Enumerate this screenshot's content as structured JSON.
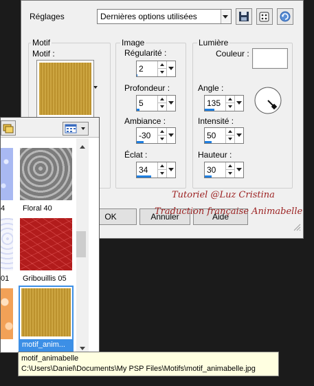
{
  "header": {
    "presets_label": "Réglages",
    "presets_value": "Dernières options utilisées",
    "icons": [
      "save-icon",
      "dice-icon",
      "reset-icon"
    ]
  },
  "motif": {
    "group_label": "Motif",
    "field_label": "Motif :"
  },
  "image": {
    "group_label": "Image",
    "regularity": {
      "label": "Régularité :",
      "value": "2",
      "level": 0.04
    },
    "depth": {
      "label": "Profondeur :",
      "value": "5",
      "level": 0.15
    },
    "ambience": {
      "label": "Ambiance :",
      "value": "-30",
      "level": 0.35
    },
    "eclat": {
      "label": "Éclat :",
      "value": "34",
      "level": 0.75
    }
  },
  "light": {
    "group_label": "Lumière",
    "color_label": "Couleur :",
    "color_value": "#ffffff",
    "angle": {
      "label": "Angle :",
      "value": "135",
      "level": 0.5
    },
    "intensity": {
      "label": "Intensité :",
      "value": "50",
      "level": 0.35
    },
    "height": {
      "label": "Hauteur :",
      "value": "30",
      "level": 0.35
    }
  },
  "buttons": {
    "ok": "OK",
    "cancel": "Annuler",
    "help": "Aide"
  },
  "credits": {
    "line1": "Tutoriel @Luz Cristina",
    "line2": "Traduction française Animabelle"
  },
  "picker": {
    "tiles": [
      {
        "caption": "4"
      },
      {
        "caption": "Floral 40"
      },
      {
        "caption": "01"
      },
      {
        "caption": "Gribouillis 05"
      },
      {
        "caption": ""
      },
      {
        "caption": "motif_anim..."
      }
    ]
  },
  "tooltip": {
    "name": "motif_animabelle",
    "path": "C:\\Users\\Daniel\\Documents\\My PSP Files\\Motifs\\motif_animabelle.jpg"
  },
  "colors": {
    "accent": "#1e7ee0",
    "credit": "#9b1f1f",
    "gold": "#c49a32"
  }
}
